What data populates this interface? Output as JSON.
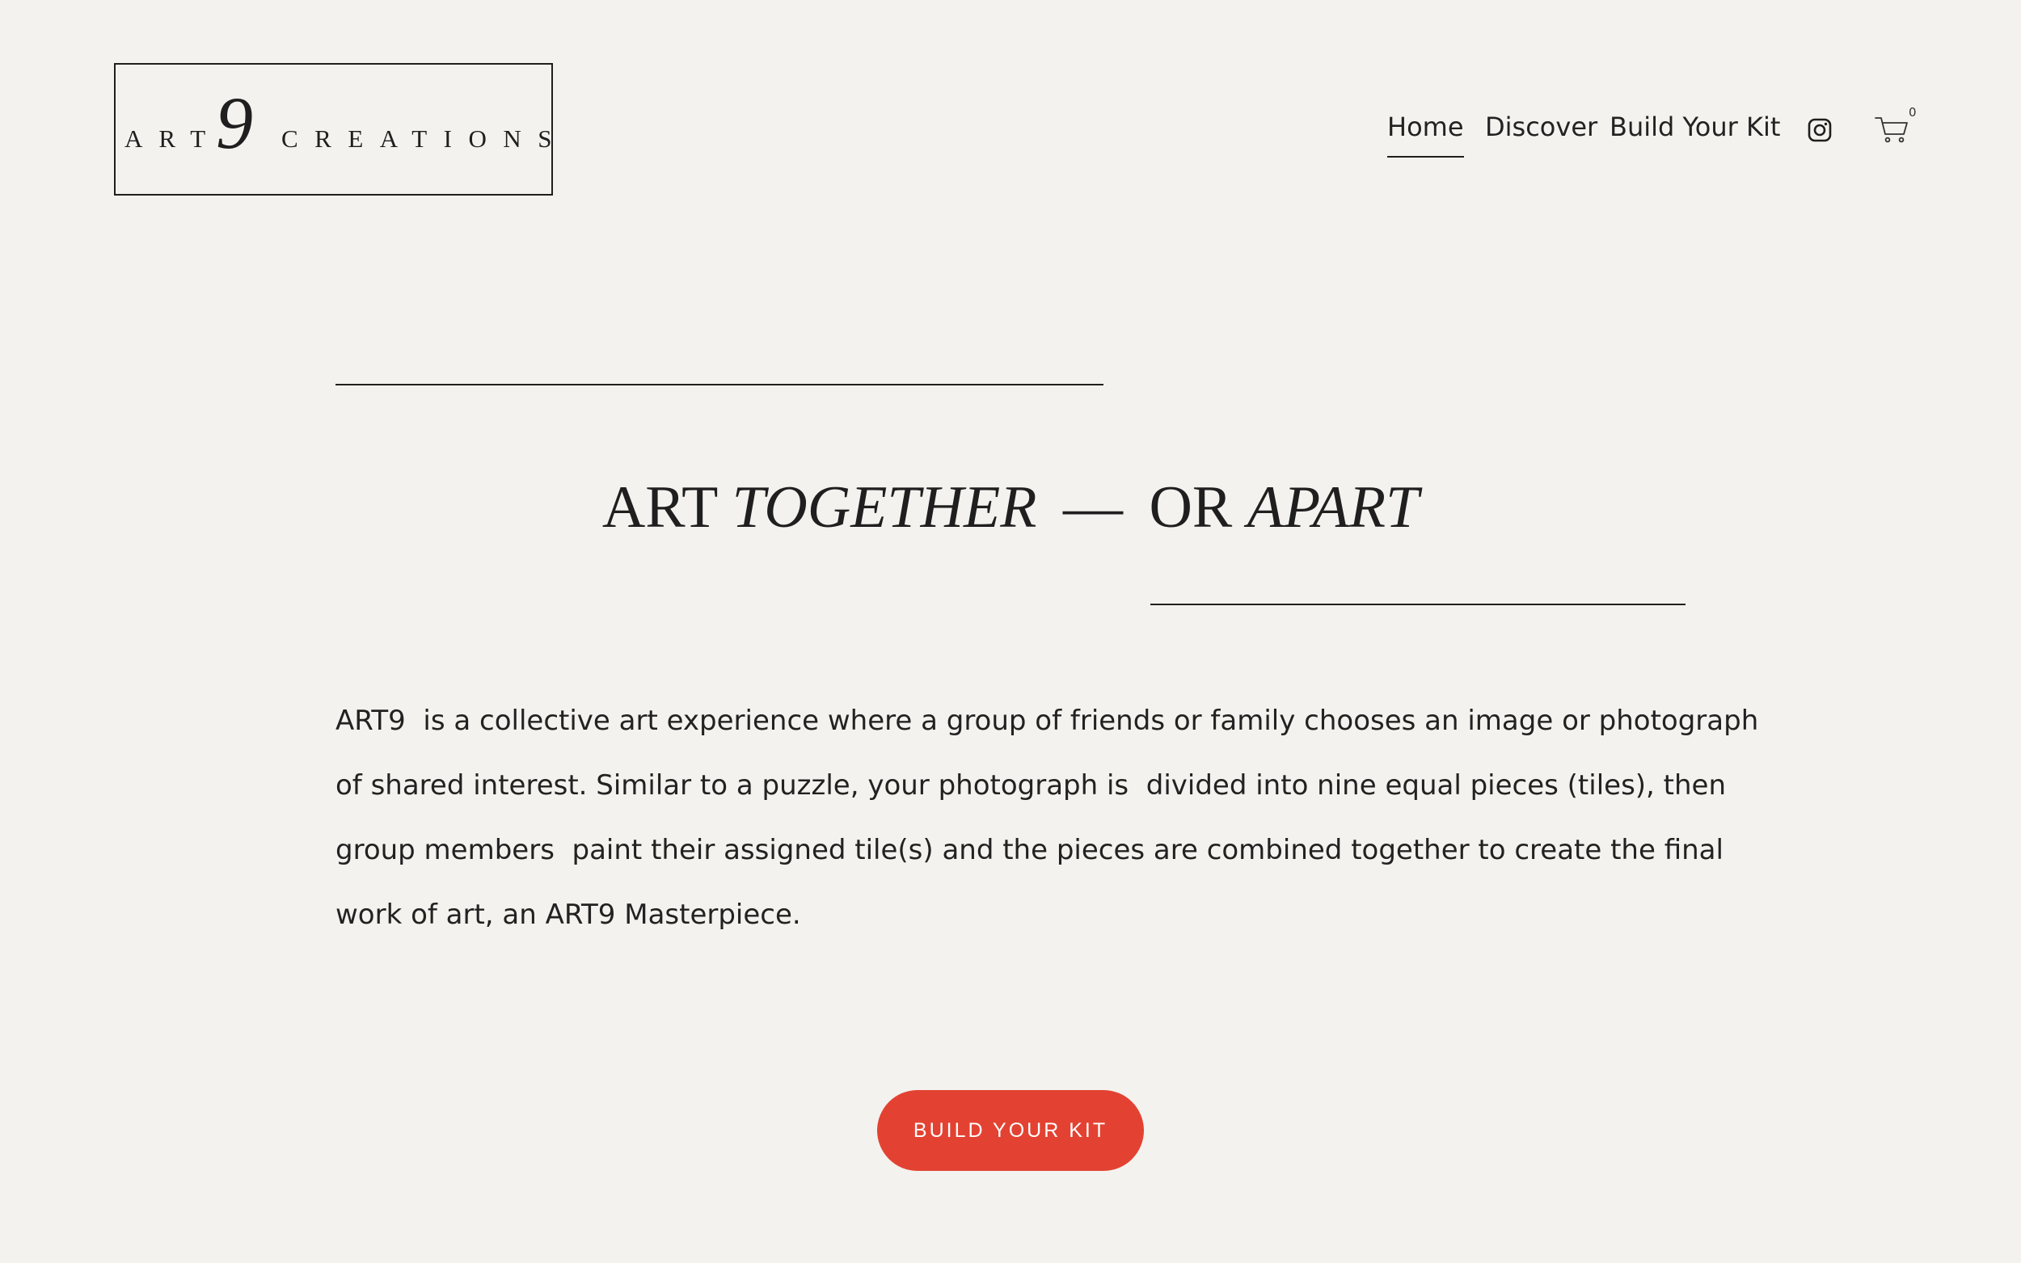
{
  "header": {
    "logo": {
      "left_text": "ART",
      "numeral": "9",
      "right_text": "CREATIONS"
    },
    "nav": {
      "items": [
        {
          "label": "Home",
          "active": true
        },
        {
          "label": "Discover"
        },
        {
          "label": "Build Your Kit"
        }
      ]
    },
    "icons": [
      "instagram-icon",
      "cart-icon"
    ],
    "cart_count": "0"
  },
  "hero": {
    "headline": {
      "part1": "ART",
      "part2": "TOGETHER",
      "dash": "—",
      "part3": "OR",
      "part4": "APART"
    },
    "intro_lines": [
      "ART9  is a collective art experience where a group of friends or family chooses an image or photograph",
      "of shared interest. Similar to a puzzle, your photograph is  divided into nine equal pieces (tiles), then",
      "group members  paint their assigned tile(s) and the pieces are combined together to create the final",
      "work of art, an ART9 Masterpiece."
    ],
    "cta_label": "BUILD YOUR KIT"
  },
  "colors": {
    "background": "#f3f2ee",
    "text": "#1f1f1f",
    "accent": "#e34232"
  }
}
